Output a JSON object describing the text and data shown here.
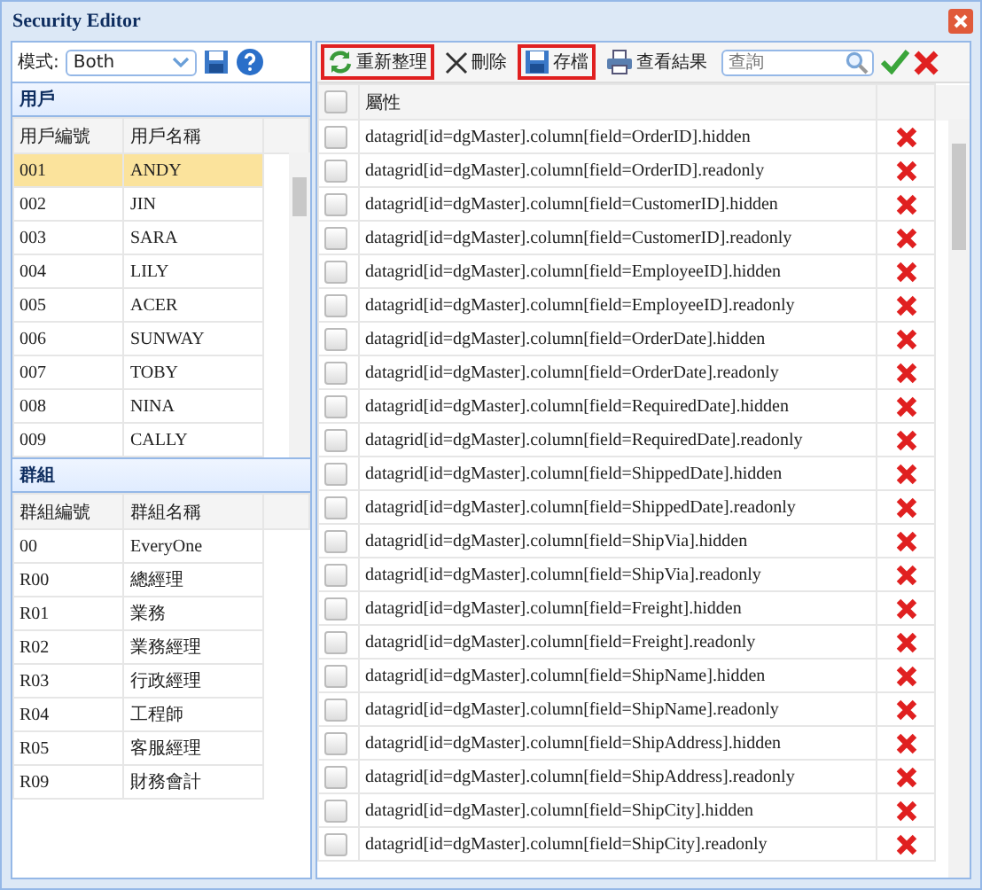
{
  "window": {
    "title": "Security Editor"
  },
  "mode": {
    "label": "模式:",
    "value": "Both"
  },
  "users": {
    "title": "用戶",
    "columns": [
      "用戶編號",
      "用戶名稱"
    ],
    "rows": [
      {
        "id": "001",
        "name": "ANDY",
        "selected": true
      },
      {
        "id": "002",
        "name": "JIN",
        "selected": false
      },
      {
        "id": "003",
        "name": "SARA",
        "selected": false
      },
      {
        "id": "004",
        "name": "LILY",
        "selected": false
      },
      {
        "id": "005",
        "name": "ACER",
        "selected": false
      },
      {
        "id": "006",
        "name": "SUNWAY",
        "selected": false
      },
      {
        "id": "007",
        "name": "TOBY",
        "selected": false
      },
      {
        "id": "008",
        "name": "NINA",
        "selected": false
      },
      {
        "id": "009",
        "name": "CALLY",
        "selected": false
      }
    ]
  },
  "groups": {
    "title": "群組",
    "columns": [
      "群組編號",
      "群組名稱"
    ],
    "rows": [
      {
        "id": "00",
        "name": "EveryOne",
        "selected": false
      },
      {
        "id": "R00",
        "name": "總經理",
        "selected": false
      },
      {
        "id": "R01",
        "name": "業務",
        "selected": false
      },
      {
        "id": "R02",
        "name": "業務經理",
        "selected": false
      },
      {
        "id": "R03",
        "name": "行政經理",
        "selected": false
      },
      {
        "id": "R04",
        "name": "工程師",
        "selected": false
      },
      {
        "id": "R05",
        "name": "客服經理",
        "selected": false
      },
      {
        "id": "R09",
        "name": "財務會計",
        "selected": false
      }
    ]
  },
  "toolbar": {
    "buttons": [
      {
        "kind": "refresh",
        "label": "重新整理",
        "highlighted": true
      },
      {
        "kind": "delete",
        "label": "刪除",
        "highlighted": false
      },
      {
        "kind": "save",
        "label": "存檔",
        "highlighted": true
      },
      {
        "kind": "print",
        "label": "查看結果",
        "highlighted": false
      }
    ],
    "search": {
      "placeholder": "查詢"
    }
  },
  "properties": {
    "column": "屬性",
    "all_checked": false,
    "rows": [
      {
        "text": "datagrid[id=dgMaster].column[field=OrderID].hidden",
        "checked": false
      },
      {
        "text": "datagrid[id=dgMaster].column[field=OrderID].readonly",
        "checked": false
      },
      {
        "text": "datagrid[id=dgMaster].column[field=CustomerID].hidden",
        "checked": false
      },
      {
        "text": "datagrid[id=dgMaster].column[field=CustomerID].readonly",
        "checked": false
      },
      {
        "text": "datagrid[id=dgMaster].column[field=EmployeeID].hidden",
        "checked": false
      },
      {
        "text": "datagrid[id=dgMaster].column[field=EmployeeID].readonly",
        "checked": false
      },
      {
        "text": "datagrid[id=dgMaster].column[field=OrderDate].hidden",
        "checked": false
      },
      {
        "text": "datagrid[id=dgMaster].column[field=OrderDate].readonly",
        "checked": false
      },
      {
        "text": "datagrid[id=dgMaster].column[field=RequiredDate].hidden",
        "checked": false
      },
      {
        "text": "datagrid[id=dgMaster].column[field=RequiredDate].readonly",
        "checked": false
      },
      {
        "text": "datagrid[id=dgMaster].column[field=ShippedDate].hidden",
        "checked": false
      },
      {
        "text": "datagrid[id=dgMaster].column[field=ShippedDate].readonly",
        "checked": false
      },
      {
        "text": "datagrid[id=dgMaster].column[field=ShipVia].hidden",
        "checked": false
      },
      {
        "text": "datagrid[id=dgMaster].column[field=ShipVia].readonly",
        "checked": false
      },
      {
        "text": "datagrid[id=dgMaster].column[field=Freight].hidden",
        "checked": false
      },
      {
        "text": "datagrid[id=dgMaster].column[field=Freight].readonly",
        "checked": false
      },
      {
        "text": "datagrid[id=dgMaster].column[field=ShipName].hidden",
        "checked": false
      },
      {
        "text": "datagrid[id=dgMaster].column[field=ShipName].readonly",
        "checked": false
      },
      {
        "text": "datagrid[id=dgMaster].column[field=ShipAddress].hidden",
        "checked": false
      },
      {
        "text": "datagrid[id=dgMaster].column[field=ShipAddress].readonly",
        "checked": false
      },
      {
        "text": "datagrid[id=dgMaster].column[field=ShipCity].hidden",
        "checked": false
      },
      {
        "text": "datagrid[id=dgMaster].column[field=ShipCity].readonly",
        "checked": false
      }
    ]
  }
}
